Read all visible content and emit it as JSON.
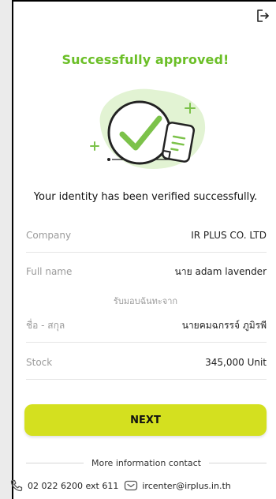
{
  "header": {
    "logout_icon": "logout-icon"
  },
  "status": {
    "title": "Successfully approved!",
    "message": "Your identity has been verified successfully.",
    "accent": "#6bbf27"
  },
  "details": [
    {
      "label": "Company",
      "value": "IR PLUS CO. LTD"
    },
    {
      "label": "Full name",
      "value": "นาย adam lavender"
    }
  ],
  "transfer": {
    "heading": "รับมอบฉันทะจาก",
    "rows": [
      {
        "label": "ชื่อ - สกุล",
        "value": "นายคมฉกรรจ์ ภูมิรพี"
      },
      {
        "label": "Stock",
        "value": "345,000 Unit"
      }
    ]
  },
  "actions": {
    "next_label": "NEXT",
    "next_color": "#d4e01f"
  },
  "contact": {
    "heading": "More information contact",
    "phone": "02 022 6200 ext 611",
    "email": "ircenter@irplus.in.th",
    "phone_icon": "phone-icon",
    "email_icon": "mail-icon"
  }
}
